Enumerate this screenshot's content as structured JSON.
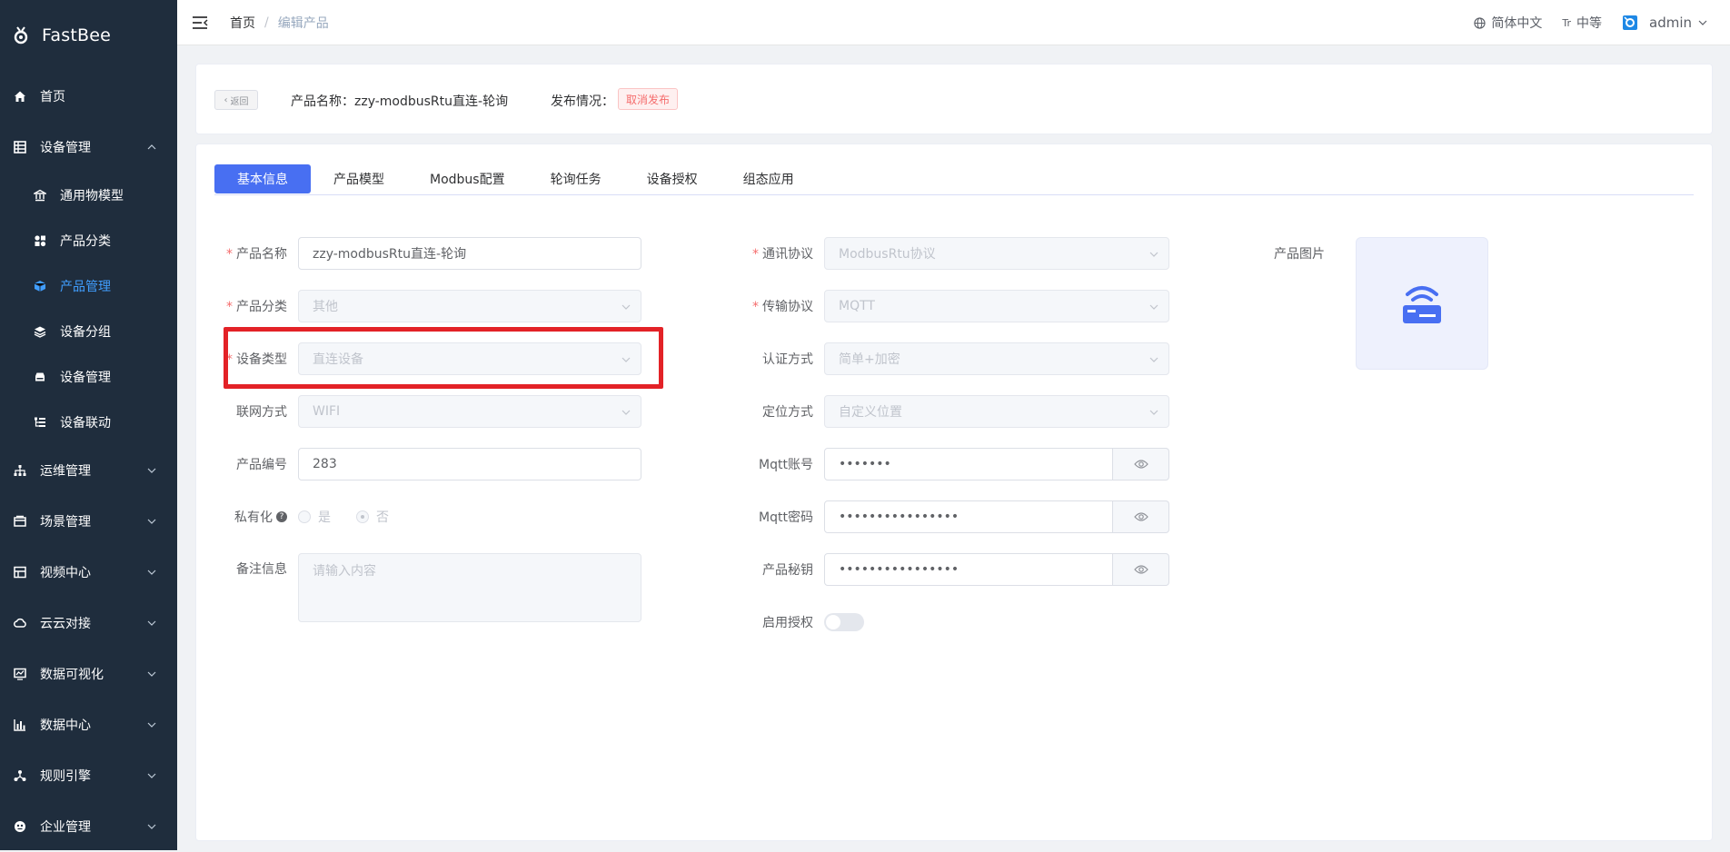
{
  "app": {
    "name": "FastBee"
  },
  "sidebar": {
    "items": [
      {
        "label": "首页"
      },
      {
        "label": "设备管理",
        "children": [
          {
            "label": "通用物模型"
          },
          {
            "label": "产品分类"
          },
          {
            "label": "产品管理",
            "active": true
          },
          {
            "label": "设备分组"
          },
          {
            "label": "设备管理"
          },
          {
            "label": "设备联动"
          }
        ]
      },
      {
        "label": "运维管理"
      },
      {
        "label": "场景管理"
      },
      {
        "label": "视频中心"
      },
      {
        "label": "云云对接"
      },
      {
        "label": "数据可视化"
      },
      {
        "label": "数据中心"
      },
      {
        "label": "规则引擎"
      },
      {
        "label": "企业管理"
      }
    ]
  },
  "header": {
    "breadcrumb": [
      "首页",
      "编辑产品"
    ],
    "breadcrumb_sep": "/",
    "language": "简体中文",
    "size": "中等",
    "size_icon": "Tr",
    "user": "admin"
  },
  "info": {
    "back_label": "返回",
    "product_name_label": "产品名称：",
    "product_name": "zzy-modbusRtu直连-轮询",
    "publish_label": "发布情况：",
    "publish_tag": "取消发布"
  },
  "tabs": [
    "基本信息",
    "产品模型",
    "Modbus配置",
    "轮询任务",
    "设备授权",
    "组态应用"
  ],
  "form": {
    "product_name": {
      "label": "产品名称",
      "value": "zzy-modbusRtu直连-轮询"
    },
    "category": {
      "label": "产品分类",
      "value": "其他"
    },
    "device_type": {
      "label": "设备类型",
      "value": "直连设备"
    },
    "network": {
      "label": "联网方式",
      "value": "WIFI"
    },
    "product_no": {
      "label": "产品编号",
      "value": "283"
    },
    "private": {
      "label": "私有化",
      "help": "?",
      "options": [
        "是",
        "否"
      ],
      "selected": "否"
    },
    "remark": {
      "label": "备注信息",
      "placeholder": "请输入内容"
    },
    "protocol": {
      "label": "通讯协议",
      "value": "ModbusRtu协议"
    },
    "transport": {
      "label": "传输协议",
      "value": "MQTT"
    },
    "auth": {
      "label": "认证方式",
      "value": "简单+加密"
    },
    "location": {
      "label": "定位方式",
      "value": "自定义位置"
    },
    "mqtt_account": {
      "label": "Mqtt账号",
      "value": "•••••••"
    },
    "mqtt_password": {
      "label": "Mqtt密码",
      "value": "••••••••••••••••"
    },
    "product_secret": {
      "label": "产品秘钥",
      "value": "••••••••••••••••"
    },
    "enable_auth": {
      "label": "启用授权",
      "enabled": false
    },
    "product_image": {
      "label": "产品图片"
    }
  },
  "colors": {
    "sidebar_bg": "#1f2d3d",
    "active": "#486ff2",
    "highlight": "#e32227"
  }
}
